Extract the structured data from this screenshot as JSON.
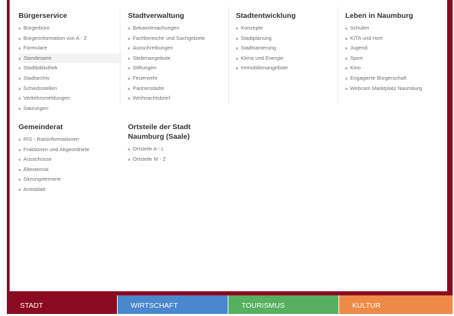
{
  "columns": [
    {
      "title": "Bürgerservice",
      "items": [
        "Bürgerbüro",
        "Bürgerinformation von A - Z",
        "Formulare",
        "Standesamt",
        "Stadtbibliothek",
        "Stadtarchiv",
        "Schiedsstellen",
        "Verkehrsmeldungen",
        "Satzungen"
      ]
    },
    {
      "title": "Stadtverwaltung",
      "items": [
        "Bekanntmachungen",
        "Fachbereiche und Sachgebiete",
        "Ausschreibungen",
        "Stellenangebote",
        "Stiftungen",
        "Feuerwehr",
        "Partnerstädte",
        "Weihnachtsbrief"
      ]
    },
    {
      "title": "Stadtentwicklung",
      "items": [
        "Konzepte",
        "Stadtplanung",
        "Stadtsanierung",
        "Klima und Energie",
        "Immobilienangebote"
      ]
    },
    {
      "title": "Leben in Naumburg",
      "items": [
        "Schulen",
        "KITA und Hort",
        "Jugend",
        "Sport",
        "Kino",
        "Engagierte Bürgerschaft",
        "Webcam Marktplatz Naumburg"
      ]
    },
    {
      "title": "Gemeinderat",
      "items": [
        "RIS - Ratsinformationen",
        "Fraktionen und Abgeordnete",
        "Ausschüsse",
        "Ältestenrat",
        "Sitzungstermine",
        "Amtsblatt"
      ]
    },
    {
      "title_line1": "Ortsteile der Stadt",
      "title_line2": "Naumburg (Saale)",
      "items": [
        "Ortsteile A - L",
        "Ortsteile M - Z"
      ]
    }
  ],
  "tabs": [
    {
      "label": "Stadt",
      "color": "#8a0a22"
    },
    {
      "label": "Wirtschaft",
      "color": "#4b87cc"
    },
    {
      "label": "Tourismus",
      "color": "#56b060"
    },
    {
      "label": "Kultur",
      "color": "#ee8a45"
    }
  ],
  "colors": {
    "frame": "#8a0a22",
    "text": "#6b6f73",
    "heading": "#2f3437"
  }
}
